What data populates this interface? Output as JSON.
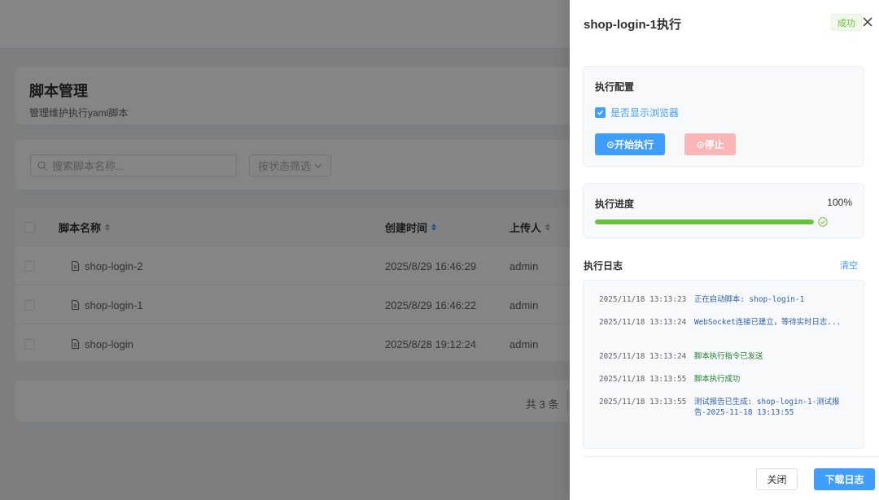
{
  "page": {
    "title": "脚本管理",
    "subtitle": "管理维护执行yaml脚本"
  },
  "filters": {
    "search_placeholder": "搜索脚本名称...",
    "status_placeholder": "按状态筛选"
  },
  "table": {
    "columns": {
      "name": "脚本名称",
      "created": "创建时间",
      "uploader": "上传人"
    },
    "rows": [
      {
        "name": "shop-login-2",
        "created": "2025/8/29 16:46:29",
        "uploader": "admin"
      },
      {
        "name": "shop-login-1",
        "created": "2025/8/29 16:46:22",
        "uploader": "admin"
      },
      {
        "name": "shop-login",
        "created": "2025/8/28 19:12:24",
        "uploader": "admin"
      }
    ]
  },
  "pagination": {
    "total_text": "共 3 条"
  },
  "drawer": {
    "title": "shop-login-1执行",
    "status": "成功",
    "config": {
      "label": "执行配置",
      "show_browser_label": "是否显示浏览器",
      "show_browser_checked": true,
      "start_label": "⊙开始执行",
      "stop_label": "⊙停止"
    },
    "progress": {
      "label": "执行进度",
      "percent_text": "100%",
      "value": 1.0
    },
    "log": {
      "label": "执行日志",
      "clear_label": "清空",
      "entries": [
        {
          "time": "2025/11/18 13:13:23",
          "message": "正在启动脚本: shop-login-1",
          "level": "info"
        },
        {
          "time": "2025/11/18 13:13:24",
          "message": "WebSocket连接已建立，等待实时日志...",
          "level": "info"
        },
        {
          "time": "2025/11/18 13:13:24",
          "message": "脚本执行指令已发送",
          "level": "success"
        },
        {
          "time": "2025/11/18 13:13:55",
          "message": "脚本执行成功",
          "level": "success"
        },
        {
          "time": "2025/11/18 13:13:55",
          "message": "测试报告已生成: shop-login-1-测试报告-2025-11-18 13:13:55",
          "level": "info"
        }
      ]
    },
    "footer": {
      "close_label": "关闭",
      "download_label": "下载日志"
    }
  },
  "colors": {
    "primary": "#409eff",
    "success": "#67c23a",
    "danger_disabled": "#fab6b6"
  }
}
